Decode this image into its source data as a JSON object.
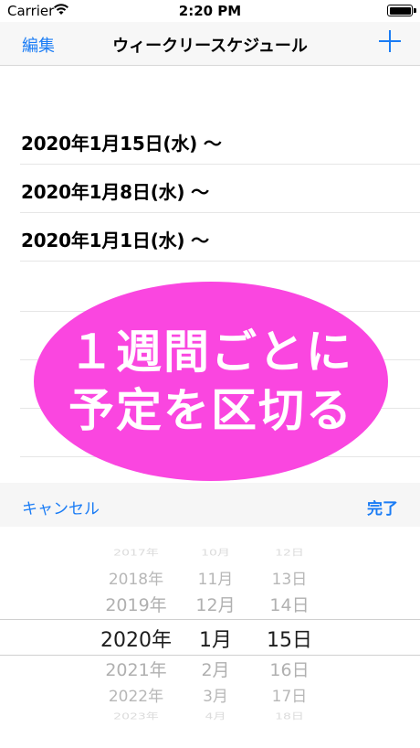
{
  "status_bar": {
    "carrier": "Carrier",
    "time": "2:20 PM"
  },
  "nav": {
    "edit_label": "編集",
    "title": "ウィークリースケジュール",
    "add_icon": "plus-icon"
  },
  "list": {
    "rows": [
      {
        "label": "2020年1月15日(水) 〜"
      },
      {
        "label": "2020年1月8日(水) 〜"
      },
      {
        "label": "2020年1月1日(水) 〜"
      }
    ]
  },
  "promo": {
    "line1": "１週間ごとに",
    "line2": "予定を区切る",
    "color": "#fa46e0"
  },
  "toolbar": {
    "cancel_label": "キャンセル",
    "done_label": "完了",
    "accent": "#1a7cf5"
  },
  "picker": {
    "years": [
      "2017年",
      "2018年",
      "2019年",
      "2020年",
      "2021年",
      "2022年",
      "2023年"
    ],
    "months": [
      "10月",
      "11月",
      "12月",
      "1月",
      "2月",
      "3月",
      "4月"
    ],
    "days": [
      "12日",
      "13日",
      "14日",
      "15日",
      "16日",
      "17日",
      "18日"
    ],
    "selected_index": 3
  }
}
